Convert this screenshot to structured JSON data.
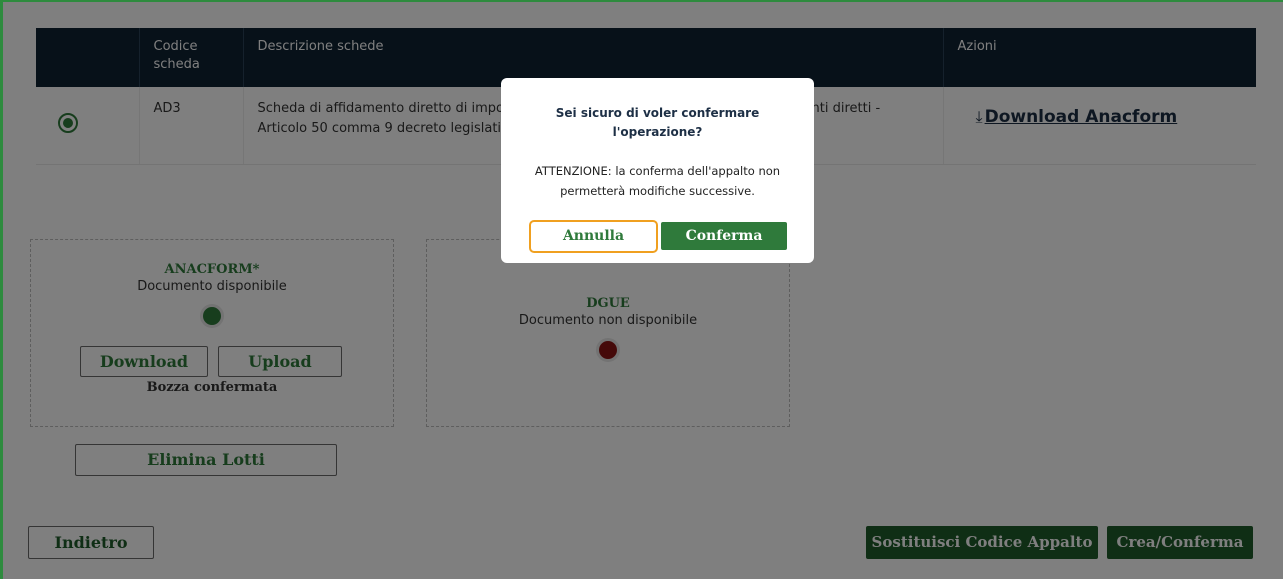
{
  "table": {
    "headers": {
      "select": "",
      "code": "Codice scheda",
      "description": "Descrizione schede",
      "actions": "Azioni"
    },
    "rows": [
      {
        "code": "AD3",
        "description": "Scheda di affidamento diretto di importo pari o superiore a 40.000 euro per affidamenti diretti - Articolo 50 comma 9 decreto legislativo 36/2023",
        "action_icon": "download-icon",
        "action_label": "Download Anacform",
        "selected": true
      }
    ]
  },
  "anacform_panel": {
    "title": "ANACFORM*",
    "status": "Documento disponibile",
    "status_color": "#2f7a3b",
    "download_label": "Download",
    "upload_label": "Upload",
    "draft_status": "Bozza confermata"
  },
  "dgue_panel": {
    "title": "DGUE",
    "status": "Documento non disponibile",
    "status_color": "#8b1515"
  },
  "buttons": {
    "delete_lots": "Elimina Lotti",
    "back": "Indietro",
    "replace_code": "Sostituisci Codice Appalto",
    "create_confirm": "Crea/Conferma"
  },
  "modal": {
    "title": "Sei sicuro di voler confermare l'operazione?",
    "message": "ATTENZIONE: la conferma dell'appalto non permetterà modifiche successive.",
    "cancel_label": "Annulla",
    "confirm_label": "Conferma"
  },
  "colors": {
    "accent_green": "#2f7a3b",
    "header_navy": "#0e2233",
    "focus_orange": "#f0a020"
  }
}
